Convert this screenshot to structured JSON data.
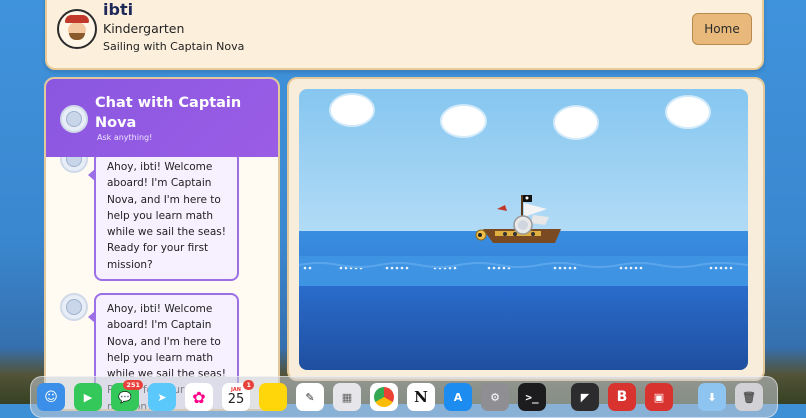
{
  "header": {
    "user_name": "ibti",
    "grade": "Kindergarten",
    "lesson": "Sailing with Captain Nova",
    "home_label": "Home"
  },
  "chat": {
    "title": "Chat with Captain Nova",
    "subtitle": "Ask anything!",
    "messages": [
      {
        "text": "Ahoy, ibti! Welcome aboard! I'm Captain Nova, and I'm here to help you learn math while we sail the seas! Ready for your first mission?"
      },
      {
        "text": "Ahoy, ibti! Welcome aboard! I'm Captain Nova, and I'm here to help you learn math while we sail the seas! Ready for your first mission?"
      }
    ]
  },
  "dock": {
    "items": [
      {
        "name": "finder-icon",
        "color": "#3b8fe8"
      },
      {
        "name": "facetime-icon",
        "color": "#34c759"
      },
      {
        "name": "messages-icon",
        "color": "#34c759",
        "badge": "251"
      },
      {
        "name": "maps-icon",
        "color": "#5ac8fa"
      },
      {
        "name": "photos-icon",
        "color": "#ffffff"
      },
      {
        "name": "calendar-icon",
        "color": "#ffffff",
        "month": "JAN",
        "day": "25",
        "badge": "1"
      },
      {
        "name": "notes-icon",
        "color": "#ffd60a"
      },
      {
        "name": "freeform-icon",
        "color": "#ffffff"
      },
      {
        "name": "launchpad-icon",
        "color": "#e5e5ea"
      },
      {
        "name": "chrome-icon",
        "color": "#ffffff"
      },
      {
        "name": "notion-icon",
        "color": "#ffffff"
      },
      {
        "name": "app-store-icon",
        "color": "#1c8cf0"
      },
      {
        "name": "system-settings-icon",
        "color": "#8e8e93"
      },
      {
        "name": "terminal-icon",
        "color": "#1c1c1e"
      },
      {
        "name": "cursor-app-icon",
        "color": "#2c2c2e"
      },
      {
        "name": "bear-app-icon",
        "color": "#d8332f"
      },
      {
        "name": "cards-app-icon",
        "color": "#d8332f"
      },
      {
        "name": "downloads-folder-icon",
        "color": "#8ec5f0"
      },
      {
        "name": "trash-icon",
        "color": "#d1d1d6"
      }
    ]
  }
}
